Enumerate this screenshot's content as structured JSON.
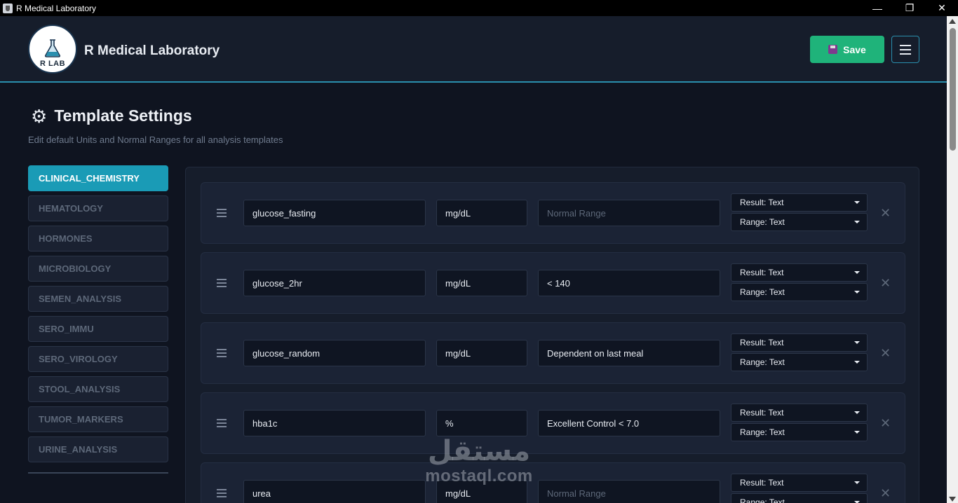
{
  "window": {
    "title": "R Medical Laboratory",
    "controls": {
      "minimize": "—",
      "maximize": "❐",
      "close": "✕"
    }
  },
  "header": {
    "logo_text": "R LAB",
    "brand": "R Medical Laboratory",
    "save_label": "Save",
    "icons": {
      "save": "floppy-disk-icon",
      "menu": "hamburger-icon"
    }
  },
  "page": {
    "title": "Template Settings",
    "subtitle": "Edit default Units and Normal Ranges for all analysis templates",
    "title_icon": "gear-icon"
  },
  "sidebar": {
    "items": [
      {
        "label": "CLINICAL_CHEMISTRY",
        "active": true
      },
      {
        "label": "HEMATOLOGY",
        "active": false
      },
      {
        "label": "HORMONES",
        "active": false
      },
      {
        "label": "MICROBIOLOGY",
        "active": false
      },
      {
        "label": "SEMEN_ANALYSIS",
        "active": false
      },
      {
        "label": "SERO_IMMU",
        "active": false
      },
      {
        "label": "SERO_VIROLOGY",
        "active": false
      },
      {
        "label": "STOOL_ANALYSIS",
        "active": false
      },
      {
        "label": "TUMOR_MARKERS",
        "active": false
      },
      {
        "label": "URINE_ANALYSIS",
        "active": false
      }
    ]
  },
  "tests": [
    {
      "name": "glucose_fasting",
      "unit": "mg/dL",
      "range": "",
      "range_placeholder": "Normal Range",
      "result_type": "Result: Text",
      "range_type": "Range: Text"
    },
    {
      "name": "glucose_2hr",
      "unit": "mg/dL",
      "range": "< 140",
      "range_placeholder": "Normal Range",
      "result_type": "Result: Text",
      "range_type": "Range: Text"
    },
    {
      "name": "glucose_random",
      "unit": "mg/dL",
      "range": "Dependent on last meal",
      "range_placeholder": "Normal Range",
      "result_type": "Result: Text",
      "range_type": "Range: Text"
    },
    {
      "name": "hba1c",
      "unit": "%",
      "range": "Excellent Control < 7.0",
      "range_placeholder": "Normal Range",
      "result_type": "Result: Text",
      "range_type": "Range: Text"
    },
    {
      "name": "urea",
      "unit": "mg/dL",
      "range": "",
      "range_placeholder": "Normal Range",
      "result_type": "Result: Text",
      "range_type": "Range: Text"
    }
  ],
  "watermark": {
    "arabic": "مستقل",
    "latin": "mostaql.com"
  },
  "colors": {
    "accent": "#1a9bb6",
    "save": "#1fb37a",
    "background": "#0f1420",
    "panel": "#161d2b"
  }
}
